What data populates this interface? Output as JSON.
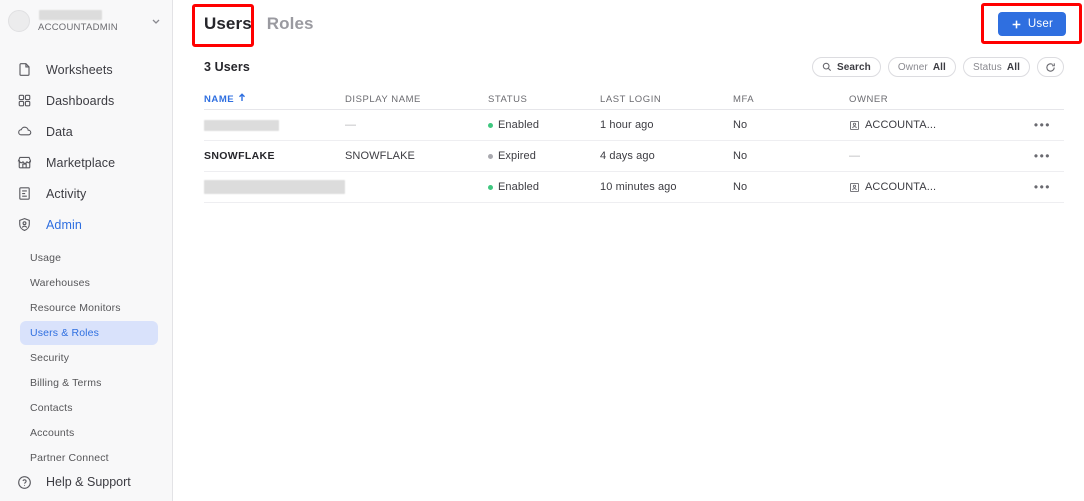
{
  "sidebar": {
    "account": {
      "name_redacted": true,
      "role": "ACCOUNTADMIN",
      "chevron_icon": "chevron-down-icon"
    },
    "nav": [
      {
        "label": "Worksheets",
        "icon": "document-icon"
      },
      {
        "label": "Dashboards",
        "icon": "grid-icon"
      },
      {
        "label": "Data",
        "icon": "cloud-icon"
      },
      {
        "label": "Marketplace",
        "icon": "storefront-icon"
      },
      {
        "label": "Activity",
        "icon": "activity-list-icon"
      },
      {
        "label": "Admin",
        "icon": "shield-person-icon"
      }
    ],
    "subnav": [
      {
        "label": "Usage",
        "selected": false
      },
      {
        "label": "Warehouses",
        "selected": false
      },
      {
        "label": "Resource Monitors",
        "selected": false
      },
      {
        "label": "Users & Roles",
        "selected": true
      },
      {
        "label": "Security",
        "selected": false
      },
      {
        "label": "Billing & Terms",
        "selected": false
      },
      {
        "label": "Contacts",
        "selected": false
      },
      {
        "label": "Accounts",
        "selected": false
      },
      {
        "label": "Partner Connect",
        "selected": false
      }
    ],
    "help": {
      "label": "Help & Support",
      "icon": "question-circle-icon"
    }
  },
  "header": {
    "tabs": [
      {
        "label": "Users",
        "active": true
      },
      {
        "label": "Roles",
        "active": false
      }
    ],
    "add_button": {
      "label": "User",
      "icon": "plus-icon",
      "color": "#2f6fe0"
    }
  },
  "toolbar": {
    "count_label": "3 Users",
    "search": {
      "label": "Search",
      "icon": "search-icon"
    },
    "owner_filter": {
      "label": "Owner",
      "value": "All"
    },
    "status_filter": {
      "label": "Status",
      "value": "All"
    },
    "refresh": {
      "icon": "refresh-icon"
    }
  },
  "table": {
    "columns": [
      {
        "label": "NAME",
        "sorted": true,
        "sort_icon": "arrow-up-icon"
      },
      {
        "label": "DISPLAY NAME",
        "sorted": false
      },
      {
        "label": "STATUS",
        "sorted": false
      },
      {
        "label": "LAST LOGIN",
        "sorted": false
      },
      {
        "label": "MFA",
        "sorted": false
      },
      {
        "label": "OWNER",
        "sorted": false
      }
    ],
    "rows": [
      {
        "name": "",
        "name_redacted": true,
        "display_name": "—",
        "status": "Enabled",
        "status_color": "#3fc77f",
        "last_login": "1 hour ago",
        "mfa": "No",
        "owner": "ACCOUNTA...",
        "owner_icon": "badge-icon",
        "actions_icon": "kebab-icon"
      },
      {
        "name": "SNOWFLAKE",
        "name_redacted": false,
        "display_name": "SNOWFLAKE",
        "status": "Expired",
        "status_color": "#a9a9af",
        "last_login": "4 days ago",
        "mfa": "No",
        "owner": "—",
        "owner_icon": null,
        "actions_icon": "kebab-icon"
      },
      {
        "name": "",
        "name_redacted": true,
        "display_name": "",
        "status": "Enabled",
        "status_color": "#3fc77f",
        "last_login": "10 minutes ago",
        "mfa": "No",
        "owner": "ACCOUNTA...",
        "owner_icon": "badge-icon",
        "actions_icon": "kebab-icon"
      }
    ]
  },
  "annotations": [
    {
      "name": "users-tab-highlight",
      "color": "#ff0000"
    },
    {
      "name": "add-user-button-highlight",
      "color": "#ff0000"
    }
  ]
}
